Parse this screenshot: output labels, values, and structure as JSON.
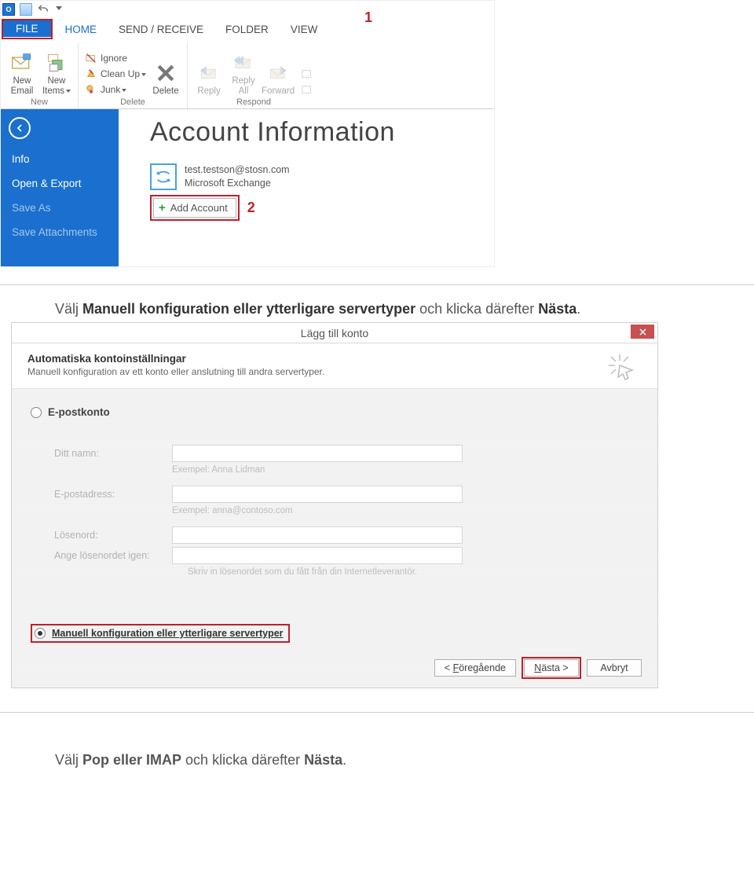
{
  "annotations": {
    "step1": "1",
    "step2": "2"
  },
  "qat": {
    "logo": "O",
    "dropdown_title": "Customize Quick Access Toolbar"
  },
  "tabs": {
    "file": "FILE",
    "home": "HOME",
    "send_receive": "SEND / RECEIVE",
    "folder": "FOLDER",
    "view": "VIEW"
  },
  "ribbon": {
    "new": {
      "group_label": "New",
      "new_email": "New\nEmail",
      "new_items": "New\nItems"
    },
    "delete": {
      "group_label": "Delete",
      "ignore": "Ignore",
      "clean_up": "Clean Up",
      "junk": "Junk",
      "delete": "Delete"
    },
    "respond": {
      "group_label": "Respond",
      "reply": "Reply",
      "reply_all": "Reply\nAll",
      "forward": "Forward"
    }
  },
  "backstage": {
    "menu": {
      "info": "Info",
      "open_export": "Open & Export",
      "save_as": "Save As",
      "save_attachments": "Save Attachments"
    },
    "title": "Account Information",
    "account_email": "test.testson@stosn.com",
    "account_type": "Microsoft Exchange",
    "add_account": "Add Account"
  },
  "instruction1": {
    "pre": "Välj ",
    "bold1": "Manuell konfiguration eller ytterligare servertyper",
    "mid": " och klicka därefter ",
    "bold2": "Nästa",
    "post": "."
  },
  "dialog": {
    "title": "Lägg till konto",
    "header_title": "Automatiska kontoinställningar",
    "header_sub": "Manuell konfiguration av ett konto eller anslutning till andra servertyper.",
    "radio_email": "E-postkonto",
    "form": {
      "name_label": "Ditt namn:",
      "name_hint": "Exempel: Anna Lidman",
      "email_label": "E-postadress:",
      "email_hint": "Exempel: anna@contoso.com",
      "pwd_label": "Lösenord:",
      "pwd2_label": "Ange lösenordet igen:",
      "pwd_hint": "Skriv in lösenordet som du fått från din Internetleverantör."
    },
    "radio_manual": "Manuell konfiguration eller ytterligare servertyper",
    "buttons": {
      "back_pre": "< ",
      "back_u": "F",
      "back_rest": "öregående",
      "next_u": "N",
      "next_rest": "ästa >",
      "cancel": "Avbryt"
    }
  },
  "instruction2": {
    "pre": "Välj ",
    "bold1": "Pop eller IMAP",
    "mid": " och klicka därefter ",
    "bold2": "Nästa",
    "post": "."
  }
}
